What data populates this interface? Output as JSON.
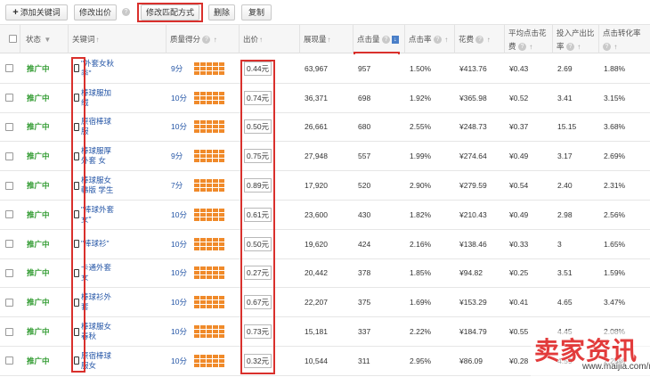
{
  "toolbar": {
    "add_keyword": "添加关键词",
    "add_icon": "+",
    "modify_bid": "修改出价",
    "modify_match": "修改匹配方式",
    "delete": "删除",
    "copy": "复制",
    "help": "?"
  },
  "columns": {
    "status": "状态",
    "status_arrow": "▼",
    "keyword": "关键词",
    "quality": "质量得分",
    "bid": "出价",
    "impressions": "展现量",
    "clicks": "点击量",
    "ctr": "点击率",
    "cost": "花费",
    "avg_cpc_1": "平均点击花",
    "avg_cpc_2": "费",
    "roi_1": "投入产出比",
    "roi_2": "率",
    "conv": "点击转化率",
    "sort_icon": "↑",
    "sort_down": "↓"
  },
  "rows": [
    {
      "status": "推广中",
      "kw1": "\"外套女秋",
      "kw2": "季\"",
      "score": "9分",
      "bid": "0.44元",
      "impr": "63,967",
      "clicks": "957",
      "ctr": "1.50%",
      "cost": "¥413.76",
      "cpc": "¥0.43",
      "roi": "2.69",
      "conv": "1.88%"
    },
    {
      "status": "推广中",
      "kw1": "棒球服加",
      "kw2": "绒",
      "score": "10分",
      "bid": "0.74元",
      "impr": "36,371",
      "clicks": "698",
      "ctr": "1.92%",
      "cost": "¥365.98",
      "cpc": "¥0.52",
      "roi": "3.41",
      "conv": "3.15%"
    },
    {
      "status": "推广中",
      "kw1": "原宿棒球",
      "kw2": "服",
      "score": "10分",
      "bid": "0.50元",
      "impr": "26,661",
      "clicks": "680",
      "ctr": "2.55%",
      "cost": "¥248.73",
      "cpc": "¥0.37",
      "roi": "15.15",
      "conv": "3.68%"
    },
    {
      "status": "推广中",
      "kw1": "棒球服厚",
      "kw2": "外套 女",
      "score": "9分",
      "bid": "0.75元",
      "impr": "27,948",
      "clicks": "557",
      "ctr": "1.99%",
      "cost": "¥274.64",
      "cpc": "¥0.49",
      "roi": "3.17",
      "conv": "2.69%"
    },
    {
      "status": "推广中",
      "kw1": "棒球服女",
      "kw2": "韩版 学生",
      "score": "7分",
      "bid": "0.89元",
      "impr": "17,920",
      "clicks": "520",
      "ctr": "2.90%",
      "cost": "¥279.59",
      "cpc": "¥0.54",
      "roi": "2.40",
      "conv": "2.31%"
    },
    {
      "status": "推广中",
      "kw1": "\"棒球外套",
      "kw2": "女\"",
      "score": "10分",
      "bid": "0.61元",
      "impr": "23,600",
      "clicks": "430",
      "ctr": "1.82%",
      "cost": "¥210.43",
      "cpc": "¥0.49",
      "roi": "2.98",
      "conv": "2.56%"
    },
    {
      "status": "推广中",
      "kw1": "\"棒球衫\"",
      "kw2": "",
      "score": "10分",
      "bid": "0.50元",
      "impr": "19,620",
      "clicks": "424",
      "ctr": "2.16%",
      "cost": "¥138.46",
      "cpc": "¥0.33",
      "roi": "3",
      "conv": "1.65%"
    },
    {
      "status": "推广中",
      "kw1": "卡通外套",
      "kw2": "女",
      "score": "10分",
      "bid": "0.27元",
      "impr": "20,442",
      "clicks": "378",
      "ctr": "1.85%",
      "cost": "¥94.82",
      "cpc": "¥0.25",
      "roi": "3.51",
      "conv": "1.59%"
    },
    {
      "status": "推广中",
      "kw1": "棒球衫外",
      "kw2": "套",
      "score": "10分",
      "bid": "0.67元",
      "impr": "22,207",
      "clicks": "375",
      "ctr": "1.69%",
      "cost": "¥153.29",
      "cpc": "¥0.41",
      "roi": "4.65",
      "conv": "3.47%"
    },
    {
      "status": "推广中",
      "kw1": "棒球服女",
      "kw2": "春秋",
      "score": "10分",
      "bid": "0.73元",
      "impr": "15,181",
      "clicks": "337",
      "ctr": "2.22%",
      "cost": "¥184.79",
      "cpc": "¥0.55",
      "roi": "4.45",
      "conv": "2.08%"
    },
    {
      "status": "推广中",
      "kw1": "原宿棒球",
      "kw2": "服女",
      "score": "10分",
      "bid": "0.32元",
      "impr": "10,544",
      "clicks": "311",
      "ctr": "2.95%",
      "cost": "¥86.09",
      "cpc": "¥0.28",
      "roi": "4.59",
      "conv": "2.25%"
    }
  ],
  "watermark": {
    "text": "卖家资讯",
    "url": "www.maijia.com/news"
  },
  "colors": {
    "status_green": "#2f9a2f",
    "link_blue": "#2455a6",
    "quality_orange": "#f08a2a",
    "highlight_red": "#d9302c"
  }
}
